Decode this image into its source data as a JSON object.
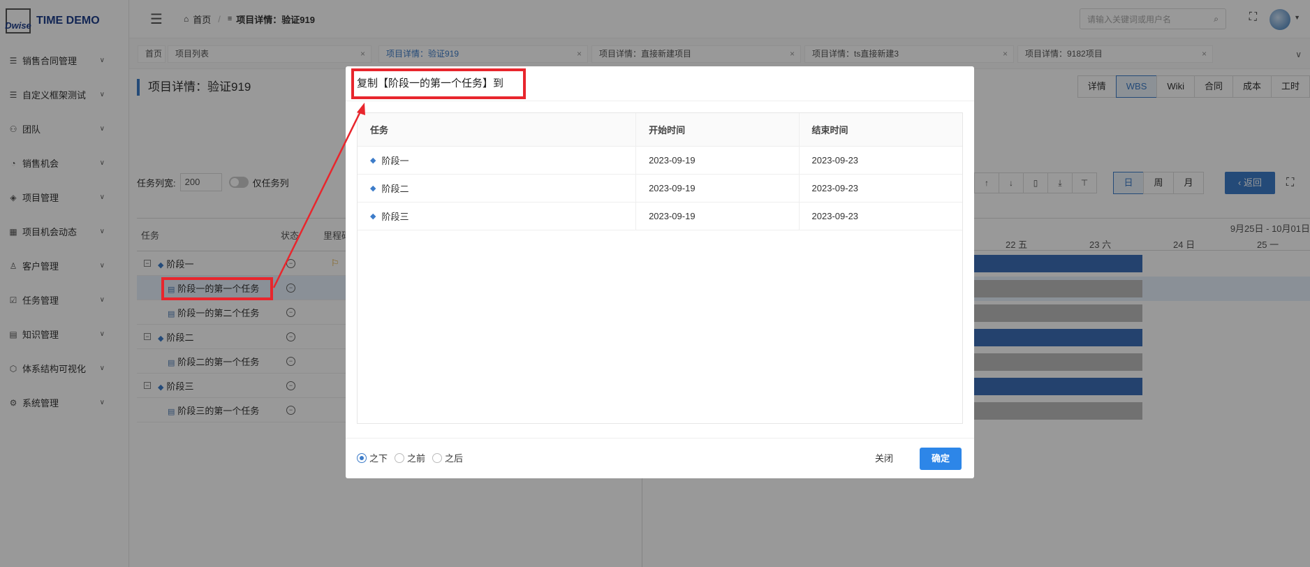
{
  "sidebar": {
    "logo_mark": "Dwise",
    "logo_text": "TIME DEMO",
    "items": [
      {
        "label": "销售合同管理",
        "icon": "list-icon"
      },
      {
        "label": "自定义框架测试",
        "icon": "list-icon"
      },
      {
        "label": "团队",
        "icon": "team-icon"
      },
      {
        "label": "销售机会",
        "icon": "pie-icon"
      },
      {
        "label": "项目管理",
        "icon": "layers-icon"
      },
      {
        "label": "项目机会动态",
        "icon": "calendar-icon"
      },
      {
        "label": "客户管理",
        "icon": "user-icon"
      },
      {
        "label": "任务管理",
        "icon": "task-icon"
      },
      {
        "label": "知识管理",
        "icon": "book-icon"
      },
      {
        "label": "体系结构可视化",
        "icon": "cube-icon"
      },
      {
        "label": "系统管理",
        "icon": "gear-icon"
      }
    ]
  },
  "header": {
    "home": "首页",
    "current": "项目详情：验证919",
    "search_placeholder": "请输入关键词或用户名"
  },
  "tabs": [
    {
      "label": "首页"
    },
    {
      "label": "项目列表"
    },
    {
      "label": "项目详情：验证919"
    },
    {
      "label": "项目详情：直接新建项目"
    },
    {
      "label": "项目详情：ts直接新建3"
    },
    {
      "label": "项目详情：9182项目"
    }
  ],
  "page": {
    "title": "项目详情：验证919",
    "view_tabs": [
      "详情",
      "WBS",
      "Wiki",
      "合同",
      "成本",
      "工时"
    ],
    "task_col_width_label": "任务列宽:",
    "task_col_width_value": "200",
    "only_task_col": "仅任务列",
    "scale": [
      "日",
      "周",
      "月"
    ],
    "back": "返回"
  },
  "grid": {
    "headers": [
      "任务",
      "状态",
      "里程碑"
    ],
    "rows": [
      {
        "label": "阶段一",
        "type": "phase"
      },
      {
        "label": "阶段一的第一个任务",
        "type": "task",
        "selected": true
      },
      {
        "label": "阶段一的第二个任务",
        "type": "task"
      },
      {
        "label": "阶段二",
        "type": "phase"
      },
      {
        "label": "阶段二的第一个任务",
        "type": "task"
      },
      {
        "label": "阶段三",
        "type": "phase"
      },
      {
        "label": "阶段三的第一个任务",
        "type": "task"
      }
    ]
  },
  "gantt": {
    "range": "9月25日 - 10月01日",
    "days": [
      "22 五",
      "23 六",
      "24 日",
      "25 一"
    ]
  },
  "modal": {
    "title": "复制【阶段一的第一个任务】到",
    "columns": [
      "任务",
      "开始时间",
      "结束时间"
    ],
    "rows": [
      {
        "task": "阶段一",
        "start": "2023-09-19",
        "end": "2023-09-23"
      },
      {
        "task": "阶段二",
        "start": "2023-09-19",
        "end": "2023-09-23"
      },
      {
        "task": "阶段三",
        "start": "2023-09-19",
        "end": "2023-09-23"
      }
    ],
    "positions": [
      "之下",
      "之前",
      "之后"
    ],
    "selected_position": "之下",
    "close": "关闭",
    "confirm": "确定"
  },
  "colors": {
    "accent": "#3d7cc9",
    "bar_phase": "#3d6eb8",
    "bar_task": "#bdbdbd",
    "annotation": "#e8262d"
  }
}
